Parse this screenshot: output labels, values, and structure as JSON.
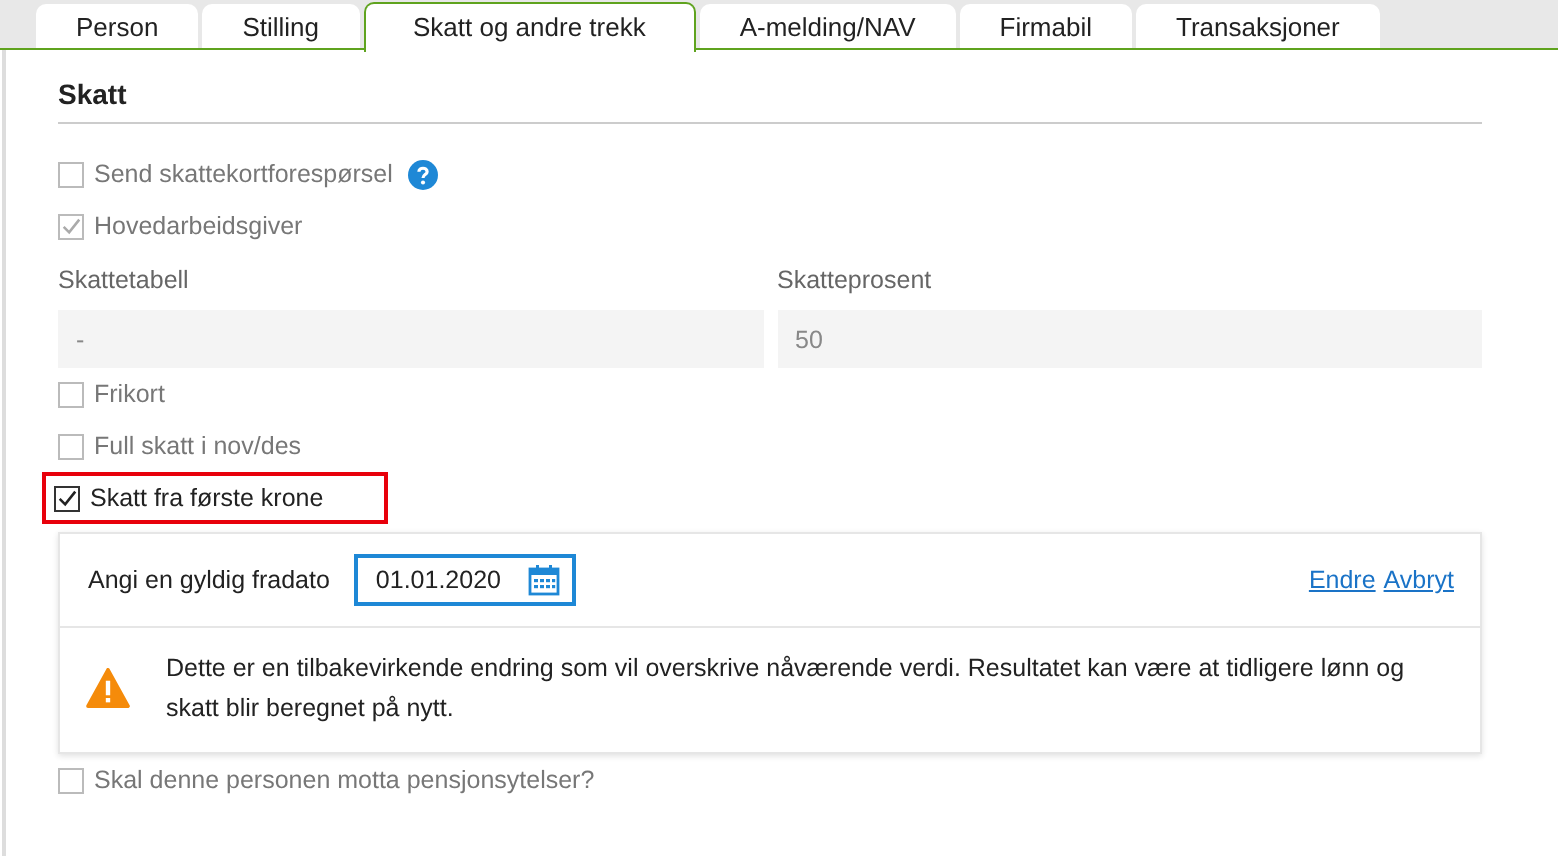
{
  "tabs": [
    {
      "label": "Person",
      "selected": false
    },
    {
      "label": "Stilling",
      "selected": false
    },
    {
      "label": "Skatt og andre trekk",
      "selected": true
    },
    {
      "label": "A-melding/NAV",
      "selected": false
    },
    {
      "label": "Firmabil",
      "selected": false
    },
    {
      "label": "Transaksjoner",
      "selected": false
    }
  ],
  "section_title": "Skatt",
  "checkboxes_top": [
    {
      "label": "Send skattekortforespørsel",
      "checked": false,
      "disabled": true,
      "highlighted": false,
      "help": true
    },
    {
      "label": "Hovedarbeidsgiver",
      "checked": true,
      "disabled": true,
      "highlighted": false,
      "help": false
    }
  ],
  "fields": [
    {
      "label": "Skattetabell",
      "value": "-",
      "disabled": true
    },
    {
      "label": "Skatteprosent",
      "value": "50",
      "disabled": true
    }
  ],
  "checkboxes_mid": [
    {
      "label": "Frikort",
      "checked": false,
      "disabled": true,
      "highlighted": false,
      "help": false
    },
    {
      "label": "Full skatt i nov/des",
      "checked": false,
      "disabled": true,
      "highlighted": false,
      "help": false
    },
    {
      "label": "Skatt fra første krone",
      "checked": true,
      "disabled": false,
      "highlighted": true,
      "help": false
    }
  ],
  "date_panel": {
    "label": "Angi en gyldig fradato",
    "value": "01.01.2020",
    "links": [
      "Endre",
      "Avbryt"
    ],
    "warning": "Dette er en tilbakevirkende endring som vil overskrive nåværende verdi. Resultatet kan være at tidligere lønn og skatt blir beregnet på nytt."
  },
  "checkboxes_bottom": [
    {
      "label": "Skal denne personen motta pensjonsytelser?",
      "checked": false,
      "disabled": true,
      "highlighted": false,
      "help": false
    }
  ]
}
